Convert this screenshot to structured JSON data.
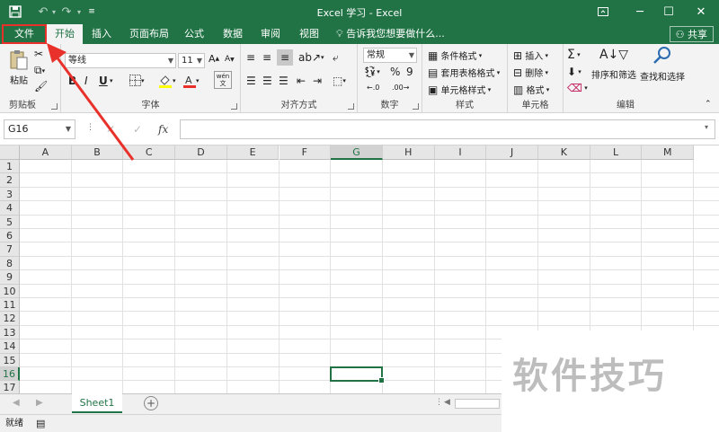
{
  "titlebar": {
    "title": "Excel 学习 - Excel",
    "save_icon": "save-icon",
    "undo_icon": "undo-icon",
    "redo_icon": "redo-icon",
    "customize_icon": "customize-qat-icon",
    "ribbon_options_icon": "ribbon-display-options-icon",
    "minimize": "─",
    "maximize": "☐",
    "close": "✕"
  },
  "tabs": [
    "文件",
    "开始",
    "插入",
    "页面布局",
    "公式",
    "数据",
    "审阅",
    "视图"
  ],
  "active_tab": "开始",
  "highlighted_tab": "文件",
  "tell_me": "告诉我您想要做什么...",
  "share": "共享",
  "ribbon": {
    "clipboard": {
      "label": "剪贴板",
      "paste": "粘贴"
    },
    "font": {
      "label": "字体",
      "name": "等线",
      "size": "11",
      "bold": "B",
      "italic": "I",
      "underline": "U",
      "wen": "wén 文"
    },
    "alignment": {
      "label": "对齐方式"
    },
    "number": {
      "label": "数字",
      "format": "常规",
      "percent": "%",
      "comma": "9"
    },
    "styles": {
      "label": "样式",
      "conditional": "条件格式",
      "table": "套用表格格式",
      "cell_styles": "单元格样式"
    },
    "cells": {
      "label": "单元格",
      "insert": "插入",
      "delete": "删除",
      "format": "格式"
    },
    "editing": {
      "label": "编辑",
      "sort": "排序和筛选",
      "find": "查找和选择"
    }
  },
  "formula_bar": {
    "name_box": "G16",
    "fx": "fx",
    "cancel": "✕",
    "enter": "✓",
    "value": ""
  },
  "columns": [
    "A",
    "B",
    "C",
    "D",
    "E",
    "F",
    "G",
    "H",
    "I",
    "J",
    "K",
    "L",
    "M"
  ],
  "rows": [
    "1",
    "2",
    "3",
    "4",
    "5",
    "6",
    "7",
    "8",
    "9",
    "10",
    "11",
    "12",
    "13",
    "14",
    "15",
    "16",
    "17"
  ],
  "selected_cell": {
    "column": "G",
    "row": "16"
  },
  "sheets": [
    "Sheet1"
  ],
  "status": {
    "ready": "就绪"
  },
  "watermark": "软件技巧",
  "colors": {
    "accent": "#217346",
    "annotation": "#e8312a"
  }
}
